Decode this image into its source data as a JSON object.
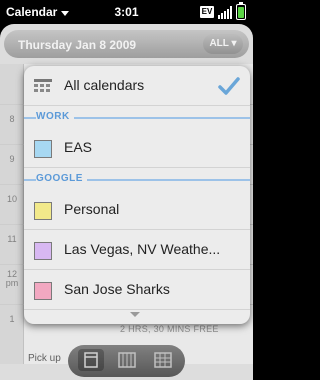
{
  "statusbar": {
    "app_name": "Calendar",
    "time": "3:01",
    "badge": "EV"
  },
  "calendar": {
    "date": "Thursday Jan 8 2009",
    "filter_button": "ALL",
    "hours": [
      "8",
      "9",
      "10",
      "11",
      "12\npm",
      "1"
    ],
    "free_time": "2 HRS, 30 MINS FREE",
    "event_snippet": "Pick up"
  },
  "popup": {
    "all_label": "All calendars",
    "sections": [
      {
        "title": "WORK",
        "items": [
          {
            "label": "EAS",
            "color": "#a7d8f2"
          }
        ]
      },
      {
        "title": "GOOGLE",
        "items": [
          {
            "label": "Personal",
            "color": "#f2e98a"
          },
          {
            "label": "Las Vegas, NV Weathe...",
            "color": "#d8b8f2"
          },
          {
            "label": "San Jose Sharks",
            "color": "#f2a8c1"
          }
        ]
      }
    ]
  },
  "colors": {
    "accent": "#5c9ad8",
    "check": "#6aa6d8"
  }
}
